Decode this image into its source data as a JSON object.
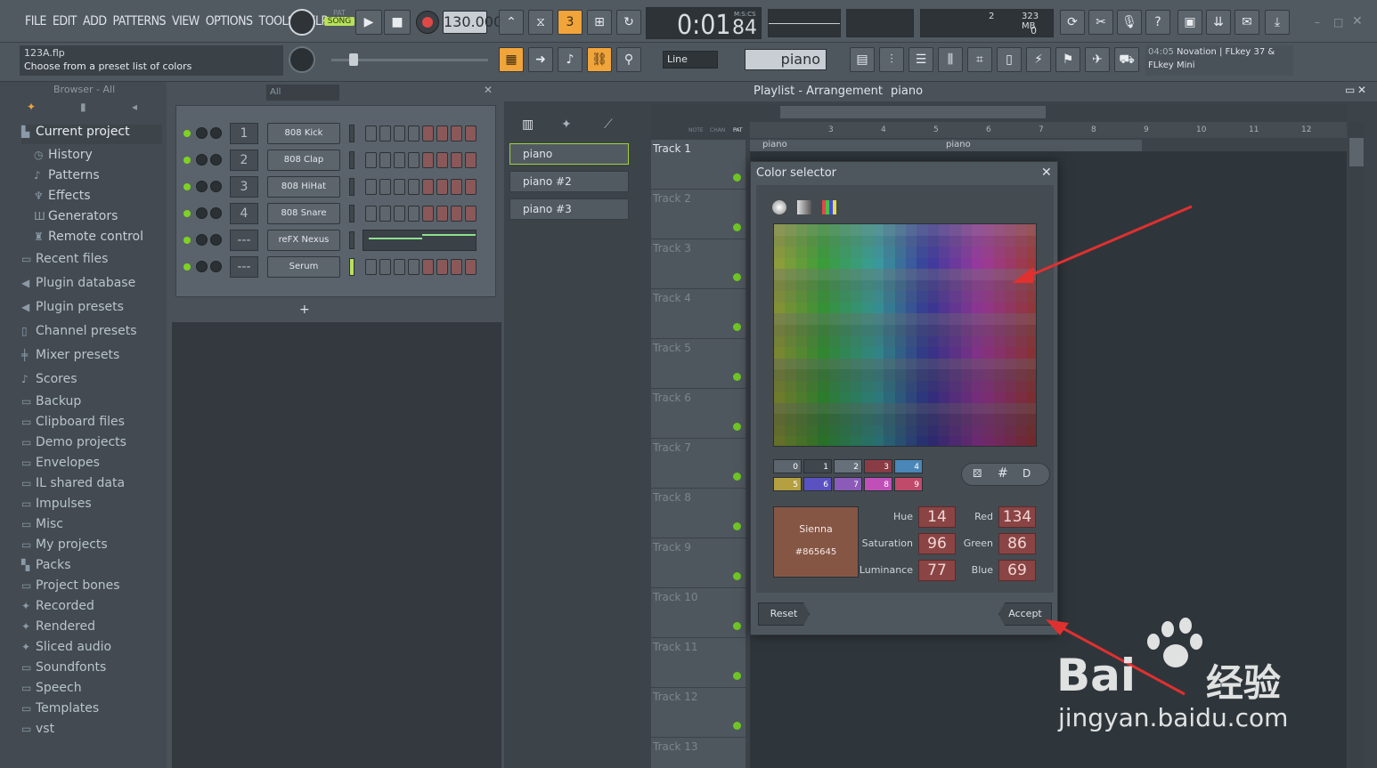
{
  "menu": [
    "FILE",
    "EDIT",
    "ADD",
    "PATTERNS",
    "VIEW",
    "OPTIONS",
    "TOOLS",
    "HELP"
  ],
  "transport": {
    "pat_label": "PAT",
    "song_label": "SONG",
    "tempo": "130.000",
    "time": "0:01",
    "time_small": "84",
    "time_unit": "M:S:CS"
  },
  "cpu": {
    "value": "2",
    "memory": "323 MB",
    "voices": "0"
  },
  "file": {
    "name": "123A.flp",
    "hint": "Choose from a preset list of colors"
  },
  "snap": "Line",
  "pattern_selector": "piano",
  "midi_device": {
    "time": "04:05",
    "name": "Novation | FLkey 37 &",
    "name2": "FLkey Mini"
  },
  "browser": {
    "header": "Browser - All",
    "items": [
      {
        "label": "Current project",
        "icon": "folder-open-icon"
      },
      {
        "label": "History",
        "icon": "history-icon",
        "sub": true
      },
      {
        "label": "Patterns",
        "icon": "note-icon",
        "sub": true
      },
      {
        "label": "Effects",
        "icon": "effects-icon",
        "sub": true
      },
      {
        "label": "Generators",
        "icon": "generator-icon",
        "sub": true
      },
      {
        "label": "Remote control",
        "icon": "remote-icon",
        "sub": true
      },
      {
        "label": "Recent files",
        "icon": "folder-icon"
      },
      {
        "label": "Plugin database",
        "icon": "plugin-icon"
      },
      {
        "label": "Plugin presets",
        "icon": "plugin-icon"
      },
      {
        "label": "Channel presets",
        "icon": "channel-icon"
      },
      {
        "label": "Mixer presets",
        "icon": "mixer-icon"
      },
      {
        "label": "Scores",
        "icon": "note-icon"
      },
      {
        "label": "Backup",
        "icon": "folder-icon"
      },
      {
        "label": "Clipboard files",
        "icon": "folder-icon"
      },
      {
        "label": "Demo projects",
        "icon": "folder-icon"
      },
      {
        "label": "Envelopes",
        "icon": "folder-icon"
      },
      {
        "label": "IL shared data",
        "icon": "folder-icon"
      },
      {
        "label": "Impulses",
        "icon": "folder-icon"
      },
      {
        "label": "Misc",
        "icon": "folder-icon"
      },
      {
        "label": "My projects",
        "icon": "folder-icon"
      },
      {
        "label": "Packs",
        "icon": "packs-icon"
      },
      {
        "label": "Project bones",
        "icon": "folder-icon"
      },
      {
        "label": "Recorded",
        "icon": "audio-icon"
      },
      {
        "label": "Rendered",
        "icon": "audio-icon"
      },
      {
        "label": "Sliced audio",
        "icon": "audio-icon"
      },
      {
        "label": "Soundfonts",
        "icon": "folder-icon"
      },
      {
        "label": "Speech",
        "icon": "folder-icon"
      },
      {
        "label": "Templates",
        "icon": "folder-icon"
      },
      {
        "label": "vst",
        "icon": "folder-icon"
      }
    ]
  },
  "channel_rack": {
    "filter": "All",
    "channels": [
      {
        "num": "1",
        "name": "808 Kick"
      },
      {
        "num": "2",
        "name": "808 Clap"
      },
      {
        "num": "3",
        "name": "808 HiHat"
      },
      {
        "num": "4",
        "name": "808 Snare"
      },
      {
        "num": "---",
        "name": "reFX Nexus"
      },
      {
        "num": "---",
        "name": "Serum"
      }
    ],
    "add_label": "+"
  },
  "playlist": {
    "title": "Playlist - Arrangement",
    "pattern": "piano",
    "patterns": [
      "piano",
      "piano #2",
      "piano #3"
    ],
    "tracks": [
      "Track 1",
      "Track 2",
      "Track 3",
      "Track 4",
      "Track 5",
      "Track 6",
      "Track 7",
      "Track 8",
      "Track 9",
      "Track 10",
      "Track 11",
      "Track 12",
      "Track 13"
    ],
    "ruler": [
      "3",
      "4",
      "5",
      "6",
      "7",
      "8",
      "9",
      "10",
      "11",
      "12"
    ],
    "clip_label": "piano",
    "header_labels": [
      "NOTE",
      "CHAN",
      "PAT"
    ]
  },
  "color_selector": {
    "title": "Color selector",
    "swatches": [
      {
        "label": "0",
        "color": "#5c656d"
      },
      {
        "label": "1",
        "color": "#3f464c"
      },
      {
        "label": "2",
        "color": "#66707a"
      },
      {
        "label": "3",
        "color": "#8a3c44"
      },
      {
        "label": "4",
        "color": "#4a86b8"
      },
      {
        "label": "5",
        "color": "#b4a040"
      },
      {
        "label": "6",
        "color": "#5a52c0"
      },
      {
        "label": "7",
        "color": "#8c5ab8"
      },
      {
        "label": "8",
        "color": "#c050b8"
      },
      {
        "label": "9",
        "color": "#c04a6a"
      }
    ],
    "mode_buttons": [
      "#",
      "D"
    ],
    "color_name": "Sienna",
    "color_hex": "#865645",
    "hue_label": "Hue",
    "hue": "14",
    "saturation_label": "Saturation",
    "saturation": "96",
    "luminance_label": "Luminance",
    "luminance": "77",
    "red_label": "Red",
    "red": "134",
    "green_label": "Green",
    "green": "86",
    "blue_label": "Blue",
    "blue": "69",
    "reset_label": "Reset",
    "accept_label": "Accept"
  },
  "watermark": {
    "brand": "Bai",
    "cn": "经验",
    "url": "jingyan.baidu.com"
  },
  "colors": {
    "accent": "#f0a43a",
    "led": "#7ed321",
    "selected_color": "#865645",
    "annotation": "#e03030"
  }
}
